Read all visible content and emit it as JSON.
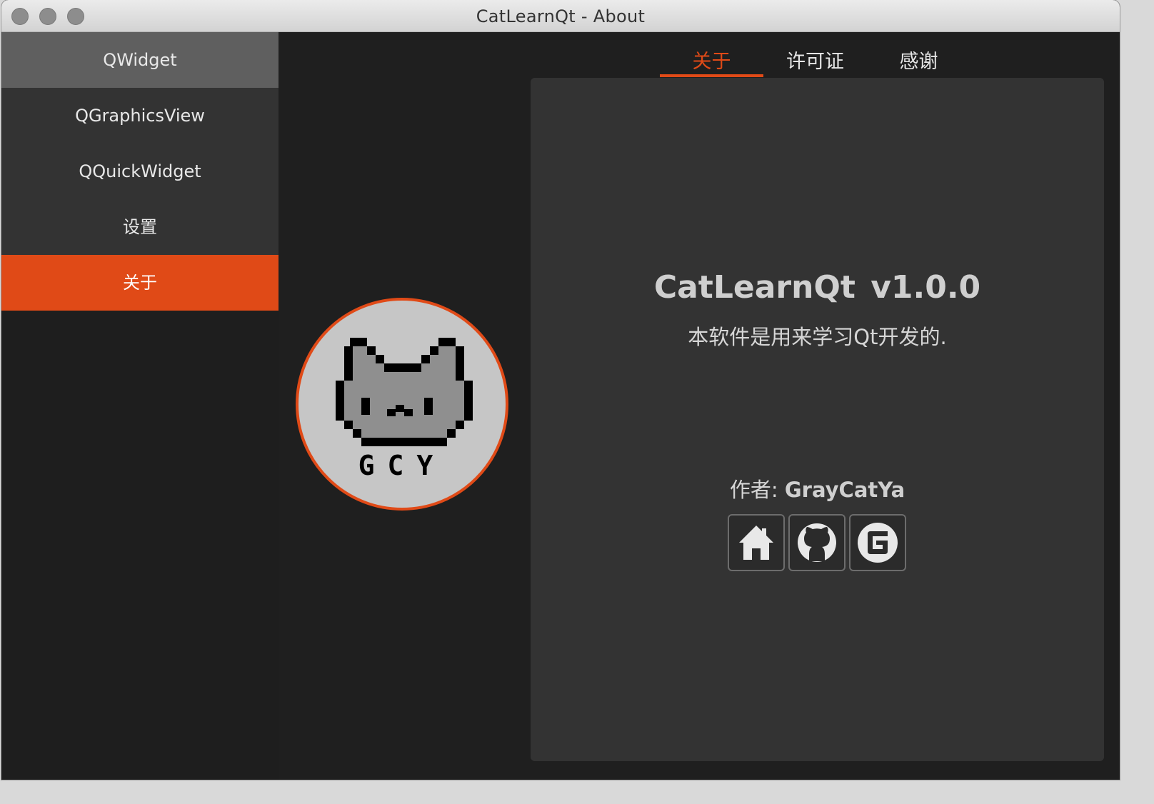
{
  "window": {
    "title": "CatLearnQt - About"
  },
  "sidebar": {
    "items": [
      {
        "label": "QWidget"
      },
      {
        "label": "QGraphicsView"
      },
      {
        "label": "QQuickWidget"
      },
      {
        "label": "设置"
      },
      {
        "label": "关于"
      }
    ],
    "active_index": 4
  },
  "tabs": [
    {
      "label": "关于"
    },
    {
      "label": "许可证"
    },
    {
      "label": "感谢"
    }
  ],
  "about": {
    "app_title": "CatLearnQt  v1.0.0",
    "description": "本软件是用来学习Qt开发的.",
    "author_label": "作者:",
    "author_name": "GrayCatYa",
    "links": [
      {
        "icon": "home-icon"
      },
      {
        "icon": "github-icon"
      },
      {
        "icon": "gitee-icon"
      }
    ]
  },
  "logo": {
    "text": "GCY"
  },
  "colors": {
    "accent": "#e04a17",
    "sidebar_bg": "#333333",
    "panel_bg": "#333333",
    "window_bg": "#1f1f1f"
  }
}
